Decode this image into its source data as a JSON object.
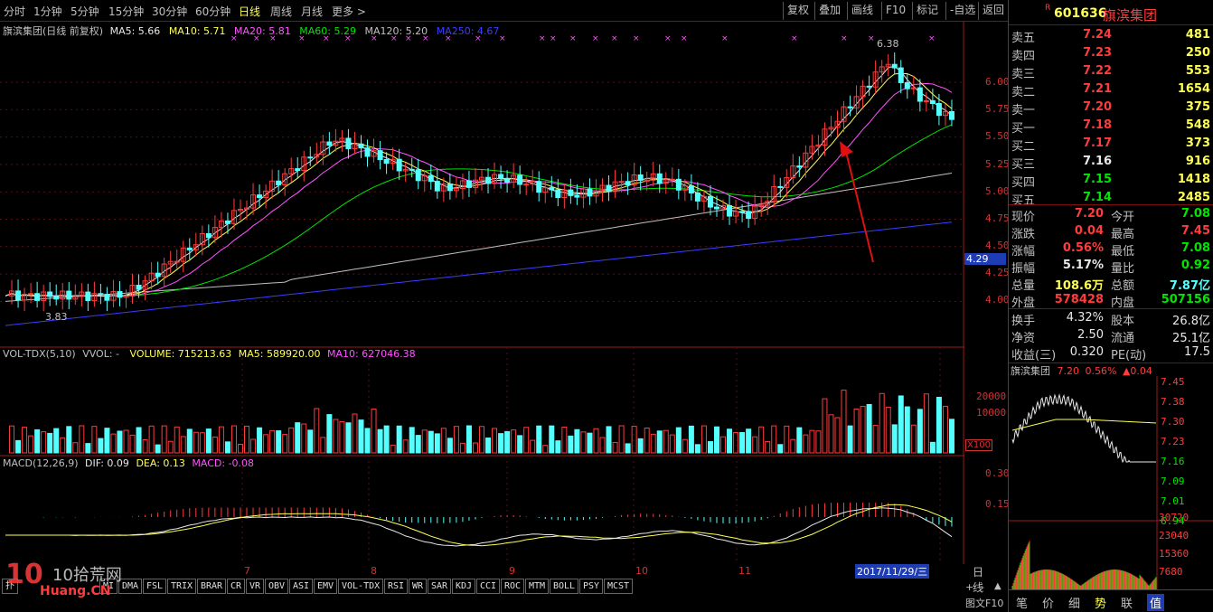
{
  "toolbar": {
    "periods": [
      "分时",
      "1分钟",
      "5分钟",
      "15分钟",
      "30分钟",
      "60分钟",
      "日线",
      "周线",
      "月线",
      "更多 >"
    ],
    "active_period": "日线",
    "buttons": [
      "复权",
      "叠加",
      "画线",
      "F10",
      "标记",
      "-自选",
      "返回"
    ]
  },
  "main_chart": {
    "title": "旗滨集团(日线 前复权)",
    "ma": [
      {
        "label": "MA5: 5.66",
        "color": "#e8e8e8"
      },
      {
        "label": "MA10: 5.71",
        "color": "#ffff54"
      },
      {
        "label": "MA20: 5.81",
        "color": "#ff54ff"
      },
      {
        "label": "MA60: 5.29",
        "color": "#00e600"
      },
      {
        "label": "MA120: 5.20",
        "color": "#c0c0c0"
      },
      {
        "label": "MA250: 4.67",
        "color": "#3c3cff"
      }
    ],
    "y_ticks": [
      "6.00",
      "5.75",
      "5.50",
      "5.25",
      "5.00",
      "4.75",
      "4.50",
      "4.25",
      "4.00"
    ],
    "current_price_tag": "4.29",
    "high_label": "6.38",
    "low_label": "3.83"
  },
  "volume_chart": {
    "title": "VOL-TDX(5,10)",
    "vvol": "VVOL: -",
    "volume": "VOLUME: 715213.63",
    "ma5": "MA5: 589920.00",
    "ma10": "MA10: 627046.38",
    "y_ticks": [
      "20000",
      "10000"
    ],
    "unit": "X100"
  },
  "macd_chart": {
    "title": "MACD(12,26,9)",
    "dif": "DIF: 0.09",
    "dea": "DEA: 0.13",
    "macd": "MACD: -0.08",
    "y_ticks": [
      "0.30",
      "0.15"
    ]
  },
  "x_axis": {
    "months": [
      "7",
      "8",
      "9",
      "10",
      "11"
    ],
    "cursor_date": "2017/11/29/三",
    "right_label": "日线"
  },
  "bottom_tabs": [
    "扑",
    "MI",
    "DMA",
    "FSL",
    "TRIX",
    "BRAR",
    "CR",
    "VR",
    "OBV",
    "ASI",
    "EMV",
    "VOL-TDX",
    "RSI",
    "WR",
    "SAR",
    "KDJ",
    "CCI",
    "ROC",
    "MTM",
    "BOLL",
    "PSY",
    "MCST"
  ],
  "watermark": {
    "line1": "10拾荒网",
    "line2": "Huang.CN"
  },
  "quote": {
    "code": "601636",
    "name": "旗滨集团",
    "sell": [
      {
        "label": "卖五",
        "price": "7.24",
        "vol": "481"
      },
      {
        "label": "卖四",
        "price": "7.23",
        "vol": "250"
      },
      {
        "label": "卖三",
        "price": "7.22",
        "vol": "553"
      },
      {
        "label": "卖二",
        "price": "7.21",
        "vol": "1654"
      },
      {
        "label": "卖一",
        "price": "7.20",
        "vol": "375"
      }
    ],
    "buy": [
      {
        "label": "买一",
        "price": "7.18",
        "vol": "548",
        "color": "red"
      },
      {
        "label": "买二",
        "price": "7.17",
        "vol": "373",
        "color": "red"
      },
      {
        "label": "买三",
        "price": "7.16",
        "vol": "916",
        "color": "white"
      },
      {
        "label": "买四",
        "price": "7.15",
        "vol": "1418",
        "color": "green"
      },
      {
        "label": "买五",
        "price": "7.14",
        "vol": "2485",
        "color": "green"
      }
    ],
    "stats": [
      {
        "l1": "现价",
        "v1": "7.20",
        "c1": "red",
        "l2": "今开",
        "v2": "7.08",
        "c2": "green"
      },
      {
        "l1": "涨跌",
        "v1": "0.04",
        "c1": "red",
        "l2": "最高",
        "v2": "7.45",
        "c2": "red"
      },
      {
        "l1": "涨幅",
        "v1": "0.56%",
        "c1": "red",
        "l2": "最低",
        "v2": "7.08",
        "c2": "green"
      },
      {
        "l1": "振幅",
        "v1": "5.17%",
        "c1": "white",
        "l2": "量比",
        "v2": "0.92",
        "c2": "green"
      },
      {
        "l1": "总量",
        "v1": "108.6万",
        "c1": "yellow",
        "l2": "总额",
        "v2": "7.87亿",
        "c2": "cyan"
      },
      {
        "l1": "外盘",
        "v1": "578428",
        "c1": "red",
        "l2": "内盘",
        "v2": "507156",
        "c2": "green"
      }
    ],
    "stats2": [
      {
        "l1": "换手",
        "v1": "4.32%",
        "l2": "股本",
        "v2": "26.8亿"
      },
      {
        "l1": "净资",
        "v1": "2.50",
        "l2": "流通",
        "v2": "25.1亿"
      },
      {
        "l1": "收益(三)",
        "v1": "0.320",
        "l2": "PE(动)",
        "v2": "17.5"
      }
    ],
    "mini": {
      "name": "旗滨集团",
      "price": "7.20",
      "pct": "0.56%",
      "chg": "▲0.04",
      "y_ticks": [
        "7.45",
        "7.38",
        "7.30",
        "7.23",
        "7.16",
        "7.09",
        "7.01",
        "6.94"
      ],
      "vol_ticks": [
        "30720",
        "23040",
        "15360",
        "7680"
      ]
    },
    "right_tabs": [
      "笔",
      "价",
      "细",
      "势",
      "联",
      "值"
    ],
    "bottom_btn": "图文F10"
  }
}
